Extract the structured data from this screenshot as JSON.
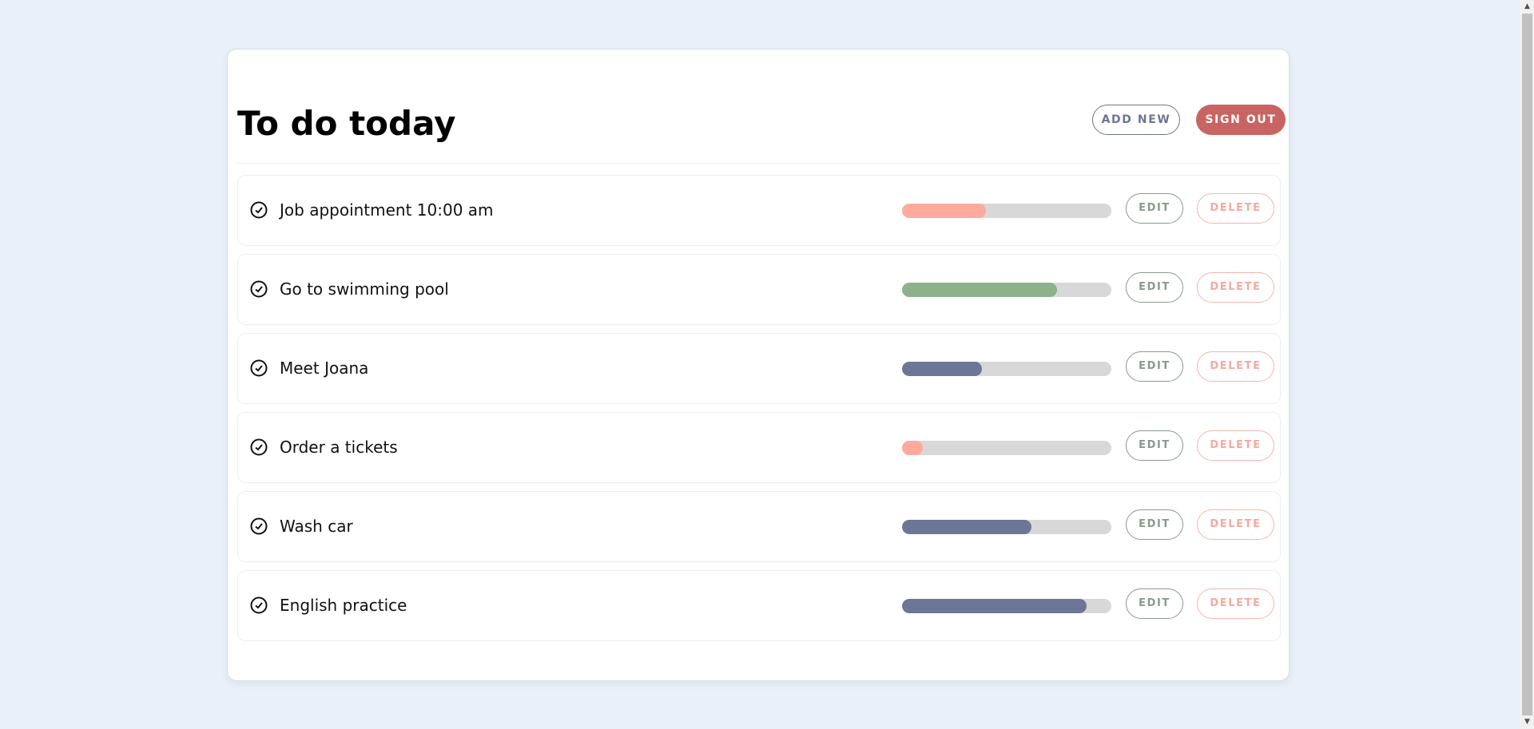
{
  "header": {
    "title": "To do today",
    "add_label": "ADD NEW",
    "signout_label": "SIGN OUT"
  },
  "tasks": [
    {
      "label": "Job appointment 10:00 am",
      "progress": 0.4,
      "color": "#ffaa9d",
      "edit_label": "EDIT",
      "delete_label": "DELETE"
    },
    {
      "label": "Go to swimming pool",
      "progress": 0.74,
      "color": "#8db28b",
      "edit_label": "EDIT",
      "delete_label": "DELETE"
    },
    {
      "label": "Meet Joana",
      "progress": 0.38,
      "color": "#6e7697",
      "edit_label": "EDIT",
      "delete_label": "DELETE"
    },
    {
      "label": "Order a tickets",
      "progress": 0.1,
      "color": "#ffaa9d",
      "edit_label": "EDIT",
      "delete_label": "DELETE"
    },
    {
      "label": "Wash car",
      "progress": 0.62,
      "color": "#6e7697",
      "edit_label": "EDIT",
      "delete_label": "DELETE"
    },
    {
      "label": "English practice",
      "progress": 0.88,
      "color": "#6e7697",
      "edit_label": "EDIT",
      "delete_label": "DELETE"
    }
  ],
  "colors": {
    "background": "#e9f0fa",
    "signout": "#c96463",
    "track": "#d8d8d8"
  }
}
